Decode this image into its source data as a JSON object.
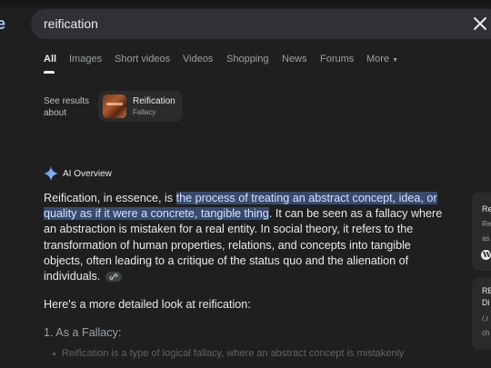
{
  "search": {
    "query": "reification"
  },
  "tabs": [
    {
      "label": "All",
      "active": true
    },
    {
      "label": "Images"
    },
    {
      "label": "Short videos"
    },
    {
      "label": "Videos"
    },
    {
      "label": "Shopping"
    },
    {
      "label": "News"
    },
    {
      "label": "Forums"
    },
    {
      "label": "More"
    }
  ],
  "see_results": {
    "label": "See results about",
    "chip_title": "Reification",
    "chip_subtitle": "Fallacy"
  },
  "ai_overview": {
    "label": "AI Overview",
    "p1_intro": "Reification, in essence, is ",
    "p1_highlight": "the process of treating an abstract concept, idea, or quality as if it were a concrete, tangible thing",
    "p1_rest": ". It can be seen as a fallacy where an abstraction is mistaken for a real entity. In social theory, it refers to the transformation of human properties, relations, and concepts into tangible objects, often leading to a critique of the status quo and the alienation of individuals.",
    "detail_line": "Here's a more detailed look at reification:",
    "section_heading": "1. As a Fallacy:",
    "bullet_text": "Reification is a type of logical fallacy, where an abstract concept is mistakenly"
  },
  "side_cards": [
    {
      "line1": "Re",
      "line2": "Re",
      "line3": "as"
    },
    {
      "line1": "RE",
      "line2": "Di",
      "line3": "/,r",
      "line4": "ch"
    }
  ],
  "colors": {
    "background": "#1f1f1f",
    "highlight": "#394a6e",
    "accent": "#a8c7fa"
  }
}
